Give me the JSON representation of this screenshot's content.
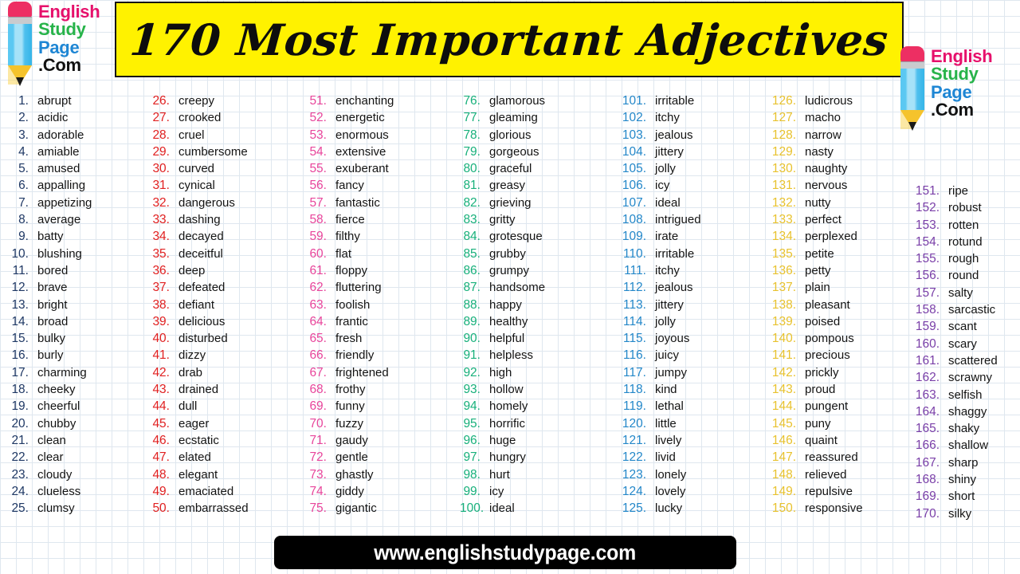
{
  "brand": {
    "logo_lines": [
      "English",
      "Study",
      "Page",
      ".Com"
    ],
    "colors": {
      "english": "#e6106b",
      "study": "#27b34a",
      "page": "#1e86d4",
      "com": "#111111",
      "pencil_eraser": "#ed2f63",
      "pencil_ferrule": "#c9cbce",
      "pencil_body": "#5bc8f2",
      "pencil_tip": "#f5c32c",
      "pencil_lead": "#1a1a1a"
    }
  },
  "header": {
    "title": "170 Most Important Adjectives",
    "banner_bg": "#fff200",
    "banner_border": "#151515"
  },
  "footer": {
    "url": "www.englishstudypage.com",
    "bg": "#000000",
    "text_color": "#ffffff"
  },
  "page_background": {
    "base": "#ffffff",
    "grid_line": "#dfe7ef",
    "grid_size_px": 20
  },
  "columns": [
    {
      "id": "column-1",
      "number_color": "#1f3864",
      "word_color": "#131313",
      "entries": [
        {
          "n": "1.",
          "w": "abrupt"
        },
        {
          "n": "2.",
          "w": "acidic"
        },
        {
          "n": "3.",
          "w": "adorable"
        },
        {
          "n": "4.",
          "w": "amiable"
        },
        {
          "n": "5.",
          "w": "amused"
        },
        {
          "n": "6.",
          "w": "appalling"
        },
        {
          "n": "7.",
          "w": "appetizing"
        },
        {
          "n": "8.",
          "w": "average"
        },
        {
          "n": "9.",
          "w": "batty"
        },
        {
          "n": "10.",
          "w": "blushing"
        },
        {
          "n": "11.",
          "w": "bored"
        },
        {
          "n": "12.",
          "w": "brave"
        },
        {
          "n": "13.",
          "w": "bright"
        },
        {
          "n": "14.",
          "w": "broad"
        },
        {
          "n": "15.",
          "w": "bulky"
        },
        {
          "n": "16.",
          "w": "burly"
        },
        {
          "n": "17.",
          "w": "charming"
        },
        {
          "n": "18.",
          "w": "cheeky"
        },
        {
          "n": "19.",
          "w": "cheerful"
        },
        {
          "n": "20.",
          "w": "chubby"
        },
        {
          "n": "21.",
          "w": "clean"
        },
        {
          "n": "22.",
          "w": "clear"
        },
        {
          "n": "23.",
          "w": "cloudy"
        },
        {
          "n": "24.",
          "w": "clueless"
        },
        {
          "n": "25.",
          "w": "clumsy"
        }
      ]
    },
    {
      "id": "column-2",
      "number_color": "#e02020",
      "word_color": "#131313",
      "entries": [
        {
          "n": "26.",
          "w": "creepy"
        },
        {
          "n": "27.",
          "w": "crooked"
        },
        {
          "n": "28.",
          "w": "cruel"
        },
        {
          "n": "29.",
          "w": "cumbersome"
        },
        {
          "n": "30.",
          "w": "curved"
        },
        {
          "n": "31.",
          "w": "cynical"
        },
        {
          "n": "32.",
          "w": "dangerous"
        },
        {
          "n": "33.",
          "w": "dashing"
        },
        {
          "n": "34.",
          "w": "decayed"
        },
        {
          "n": "35.",
          "w": "deceitful"
        },
        {
          "n": "36.",
          "w": "deep"
        },
        {
          "n": "37.",
          "w": "defeated"
        },
        {
          "n": "38.",
          "w": "defiant"
        },
        {
          "n": "39.",
          "w": "delicious"
        },
        {
          "n": "40.",
          "w": "disturbed"
        },
        {
          "n": "41.",
          "w": "dizzy"
        },
        {
          "n": "42.",
          "w": "drab"
        },
        {
          "n": "43.",
          "w": "drained"
        },
        {
          "n": "44.",
          "w": "dull"
        },
        {
          "n": "45.",
          "w": "eager"
        },
        {
          "n": "46.",
          "w": "ecstatic"
        },
        {
          "n": "47.",
          "w": "elated"
        },
        {
          "n": "48.",
          "w": "elegant"
        },
        {
          "n": "49.",
          "w": "emaciated"
        },
        {
          "n": "50.",
          "w": "embarrassed"
        }
      ]
    },
    {
      "id": "column-3",
      "number_color": "#e8459b",
      "word_color": "#131313",
      "entries": [
        {
          "n": "51.",
          "w": "enchanting"
        },
        {
          "n": "52.",
          "w": "energetic"
        },
        {
          "n": "53.",
          "w": "enormous"
        },
        {
          "n": "54.",
          "w": "extensive"
        },
        {
          "n": "55.",
          "w": "exuberant"
        },
        {
          "n": "56.",
          "w": "fancy"
        },
        {
          "n": "57.",
          "w": "fantastic"
        },
        {
          "n": "58.",
          "w": "fierce"
        },
        {
          "n": "59.",
          "w": "filthy"
        },
        {
          "n": "60.",
          "w": "flat"
        },
        {
          "n": "61.",
          "w": "floppy"
        },
        {
          "n": "62.",
          "w": "fluttering"
        },
        {
          "n": "63.",
          "w": "foolish"
        },
        {
          "n": "64.",
          "w": "frantic"
        },
        {
          "n": "65.",
          "w": "fresh"
        },
        {
          "n": "66.",
          "w": "friendly"
        },
        {
          "n": "67.",
          "w": "frightened"
        },
        {
          "n": "68.",
          "w": "frothy"
        },
        {
          "n": "69.",
          "w": "funny"
        },
        {
          "n": "70.",
          "w": "fuzzy"
        },
        {
          "n": "71.",
          "w": "gaudy"
        },
        {
          "n": "72.",
          "w": "gentle"
        },
        {
          "n": "73.",
          "w": "ghastly"
        },
        {
          "n": "74.",
          "w": "giddy"
        },
        {
          "n": "75.",
          "w": "gigantic"
        }
      ]
    },
    {
      "id": "column-4",
      "number_color": "#17b07b",
      "word_color": "#131313",
      "entries": [
        {
          "n": "76.",
          "w": "glamorous"
        },
        {
          "n": "77.",
          "w": "gleaming"
        },
        {
          "n": "78.",
          "w": "glorious"
        },
        {
          "n": "79.",
          "w": "gorgeous"
        },
        {
          "n": "80.",
          "w": "graceful"
        },
        {
          "n": "81.",
          "w": "greasy"
        },
        {
          "n": "82.",
          "w": "grieving"
        },
        {
          "n": "83.",
          "w": "gritty"
        },
        {
          "n": "84.",
          "w": "grotesque"
        },
        {
          "n": "85.",
          "w": "grubby"
        },
        {
          "n": "86.",
          "w": "grumpy"
        },
        {
          "n": "87.",
          "w": "handsome"
        },
        {
          "n": "88.",
          "w": "happy"
        },
        {
          "n": "89.",
          "w": "healthy"
        },
        {
          "n": "90.",
          "w": "helpful"
        },
        {
          "n": "91.",
          "w": "helpless"
        },
        {
          "n": "92.",
          "w": "high"
        },
        {
          "n": "93.",
          "w": "hollow"
        },
        {
          "n": "94.",
          "w": "homely"
        },
        {
          "n": "95.",
          "w": "horrific"
        },
        {
          "n": "96.",
          "w": "huge"
        },
        {
          "n": "97.",
          "w": "hungry"
        },
        {
          "n": "98.",
          "w": "hurt"
        },
        {
          "n": "99.",
          "w": "icy"
        },
        {
          "n": "100.",
          "w": "ideal"
        }
      ]
    },
    {
      "id": "column-5",
      "number_color": "#2387c9",
      "word_color": "#131313",
      "entries": [
        {
          "n": "101.",
          "w": "irritable"
        },
        {
          "n": "102.",
          "w": "itchy"
        },
        {
          "n": "103.",
          "w": "jealous"
        },
        {
          "n": "104.",
          "w": "jittery"
        },
        {
          "n": "105.",
          "w": "jolly"
        },
        {
          "n": "106.",
          "w": "icy"
        },
        {
          "n": "107.",
          "w": "ideal"
        },
        {
          "n": "108.",
          "w": "intrigued"
        },
        {
          "n": "109.",
          "w": "irate"
        },
        {
          "n": "110.",
          "w": "irritable"
        },
        {
          "n": "111.",
          "w": "itchy"
        },
        {
          "n": "112.",
          "w": "jealous"
        },
        {
          "n": "113.",
          "w": "jittery"
        },
        {
          "n": "114.",
          "w": "jolly"
        },
        {
          "n": "115.",
          "w": "joyous"
        },
        {
          "n": "116.",
          "w": "juicy"
        },
        {
          "n": "117.",
          "w": "jumpy"
        },
        {
          "n": "118.",
          "w": "kind"
        },
        {
          "n": "119.",
          "w": "lethal"
        },
        {
          "n": "120.",
          "w": "little"
        },
        {
          "n": "121.",
          "w": "lively"
        },
        {
          "n": "122.",
          "w": "livid"
        },
        {
          "n": "123.",
          "w": "lonely"
        },
        {
          "n": "124.",
          "w": "lovely"
        },
        {
          "n": "125.",
          "w": "lucky"
        }
      ]
    },
    {
      "id": "column-6",
      "number_color": "#e8c22e",
      "word_color": "#131313",
      "entries": [
        {
          "n": "126.",
          "w": "ludicrous"
        },
        {
          "n": "127.",
          "w": "macho"
        },
        {
          "n": "128.",
          "w": "narrow"
        },
        {
          "n": "129.",
          "w": "nasty"
        },
        {
          "n": "130.",
          "w": "naughty"
        },
        {
          "n": "131.",
          "w": "nervous"
        },
        {
          "n": "132.",
          "w": "nutty"
        },
        {
          "n": "133.",
          "w": "perfect"
        },
        {
          "n": "134.",
          "w": "perplexed"
        },
        {
          "n": "135.",
          "w": "petite"
        },
        {
          "n": "136.",
          "w": "petty"
        },
        {
          "n": "137.",
          "w": "plain"
        },
        {
          "n": "138.",
          "w": "pleasant"
        },
        {
          "n": "139.",
          "w": "poised"
        },
        {
          "n": "140.",
          "w": "pompous"
        },
        {
          "n": "141.",
          "w": "precious"
        },
        {
          "n": "142.",
          "w": "prickly"
        },
        {
          "n": "143.",
          "w": "proud"
        },
        {
          "n": "144.",
          "w": "pungent"
        },
        {
          "n": "145.",
          "w": "puny"
        },
        {
          "n": "146.",
          "w": "quaint"
        },
        {
          "n": "147.",
          "w": "reassured"
        },
        {
          "n": "148.",
          "w": "relieved"
        },
        {
          "n": "149.",
          "w": "repulsive"
        },
        {
          "n": "150.",
          "w": "responsive"
        }
      ]
    },
    {
      "id": "column-7",
      "number_color": "#7a3fa8",
      "word_color": "#131313",
      "entries": [
        {
          "n": "151.",
          "w": "ripe"
        },
        {
          "n": "152.",
          "w": "robust"
        },
        {
          "n": "153.",
          "w": "rotten"
        },
        {
          "n": "154.",
          "w": "rotund"
        },
        {
          "n": "155.",
          "w": "rough"
        },
        {
          "n": "156.",
          "w": "round"
        },
        {
          "n": "157.",
          "w": "salty"
        },
        {
          "n": "158.",
          "w": "sarcastic"
        },
        {
          "n": "159.",
          "w": "scant"
        },
        {
          "n": "160.",
          "w": "scary"
        },
        {
          "n": "161.",
          "w": "scattered"
        },
        {
          "n": "162.",
          "w": "scrawny"
        },
        {
          "n": "163.",
          "w": "selfish"
        },
        {
          "n": "164.",
          "w": "shaggy"
        },
        {
          "n": "165.",
          "w": "shaky"
        },
        {
          "n": "166.",
          "w": "shallow"
        },
        {
          "n": "167.",
          "w": "sharp"
        },
        {
          "n": "168.",
          "w": "shiny"
        },
        {
          "n": "169.",
          "w": "short"
        },
        {
          "n": "170.",
          "w": "silky"
        }
      ]
    }
  ]
}
